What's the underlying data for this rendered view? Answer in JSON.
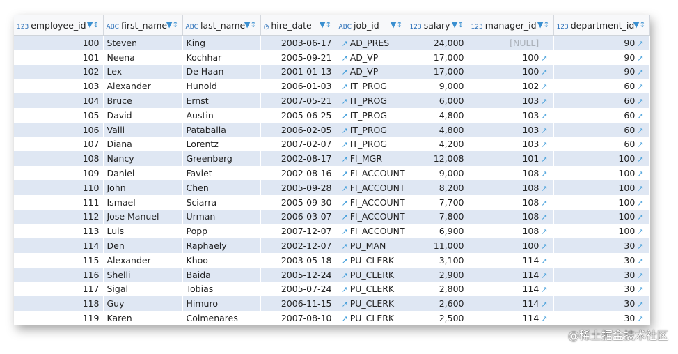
{
  "columns": [
    {
      "name": "employee_id",
      "type": "123"
    },
    {
      "name": "first_name",
      "type": "ABC"
    },
    {
      "name": "last_name",
      "type": "ABC"
    },
    {
      "name": "hire_date",
      "type": "date"
    },
    {
      "name": "job_id",
      "type": "ABC"
    },
    {
      "name": "salary",
      "type": "123"
    },
    {
      "name": "manager_id",
      "type": "123"
    },
    {
      "name": "department_id",
      "type": "123"
    }
  ],
  "rows": [
    [
      "100",
      "Steven",
      "King",
      "2003-06-17",
      "AD_PRES",
      "24,000",
      "[NULL]",
      "90"
    ],
    [
      "101",
      "Neena",
      "Kochhar",
      "2005-09-21",
      "AD_VP",
      "17,000",
      "100",
      "90"
    ],
    [
      "102",
      "Lex",
      "De Haan",
      "2001-01-13",
      "AD_VP",
      "17,000",
      "100",
      "90"
    ],
    [
      "103",
      "Alexander",
      "Hunold",
      "2006-01-03",
      "IT_PROG",
      "9,000",
      "102",
      "60"
    ],
    [
      "104",
      "Bruce",
      "Ernst",
      "2007-05-21",
      "IT_PROG",
      "6,000",
      "103",
      "60"
    ],
    [
      "105",
      "David",
      "Austin",
      "2005-06-25",
      "IT_PROG",
      "4,800",
      "103",
      "60"
    ],
    [
      "106",
      "Valli",
      "Pataballa",
      "2006-02-05",
      "IT_PROG",
      "4,800",
      "103",
      "60"
    ],
    [
      "107",
      "Diana",
      "Lorentz",
      "2007-02-07",
      "IT_PROG",
      "4,200",
      "103",
      "60"
    ],
    [
      "108",
      "Nancy",
      "Greenberg",
      "2002-08-17",
      "FI_MGR",
      "12,008",
      "101",
      "100"
    ],
    [
      "109",
      "Daniel",
      "Faviet",
      "2002-08-16",
      "FI_ACCOUNT",
      "9,000",
      "108",
      "100"
    ],
    [
      "110",
      "John",
      "Chen",
      "2005-09-28",
      "FI_ACCOUNT",
      "8,200",
      "108",
      "100"
    ],
    [
      "111",
      "Ismael",
      "Sciarra",
      "2005-09-30",
      "FI_ACCOUNT",
      "7,700",
      "108",
      "100"
    ],
    [
      "112",
      "Jose Manuel",
      "Urman",
      "2006-03-07",
      "FI_ACCOUNT",
      "7,800",
      "108",
      "100"
    ],
    [
      "113",
      "Luis",
      "Popp",
      "2007-12-07",
      "FI_ACCOUNT",
      "6,900",
      "108",
      "100"
    ],
    [
      "114",
      "Den",
      "Raphaely",
      "2002-12-07",
      "PU_MAN",
      "11,000",
      "100",
      "30"
    ],
    [
      "115",
      "Alexander",
      "Khoo",
      "2003-05-18",
      "PU_CLERK",
      "3,100",
      "114",
      "30"
    ],
    [
      "116",
      "Shelli",
      "Baida",
      "2005-12-24",
      "PU_CLERK",
      "2,900",
      "114",
      "30"
    ],
    [
      "117",
      "Sigal",
      "Tobias",
      "2005-07-24",
      "PU_CLERK",
      "2,800",
      "114",
      "30"
    ],
    [
      "118",
      "Guy",
      "Himuro",
      "2006-11-15",
      "PU_CLERK",
      "2,600",
      "114",
      "30"
    ],
    [
      "119",
      "Karen",
      "Colmenares",
      "2007-08-10",
      "PU_CLERK",
      "2,500",
      "114",
      "30"
    ]
  ],
  "watermark": "@稀土掘金技术社区"
}
